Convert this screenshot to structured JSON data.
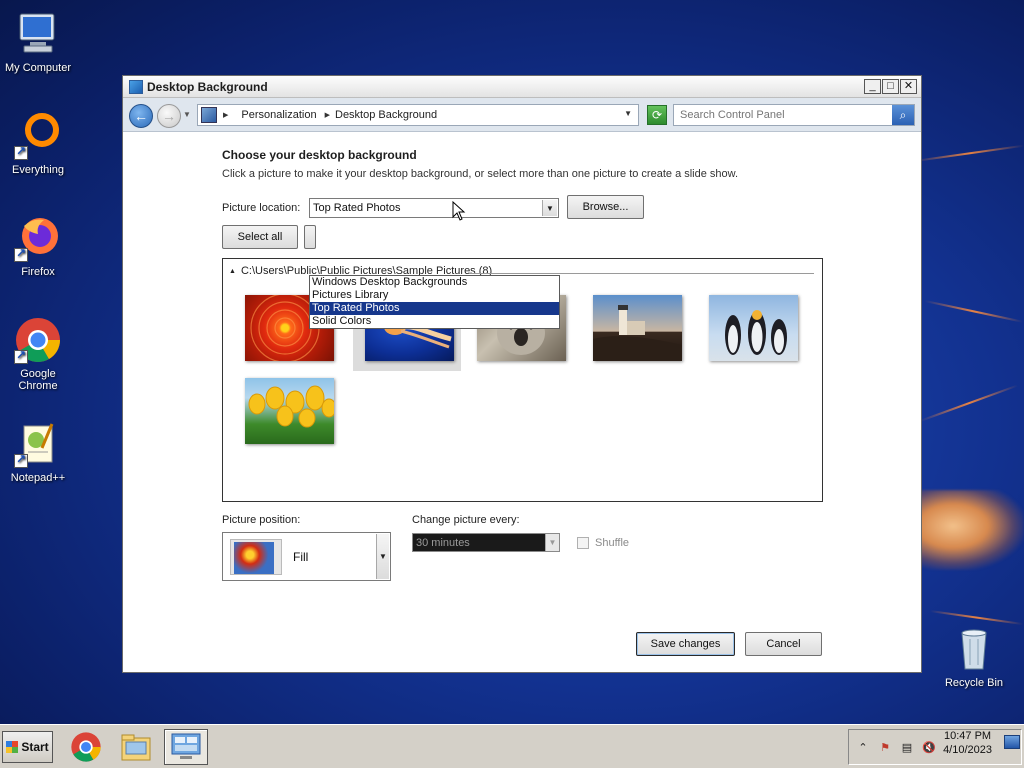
{
  "desktop": {
    "icons": [
      {
        "label": "My Computer"
      },
      {
        "label": "Everything"
      },
      {
        "label": "Firefox"
      },
      {
        "label": "Google Chrome"
      },
      {
        "label": "Notepad++"
      },
      {
        "label": "Recycle Bin"
      }
    ]
  },
  "window": {
    "title": "Desktop Background",
    "controls": {
      "minimize": "_",
      "maximize": "□",
      "close": "✕"
    }
  },
  "addressbar": {
    "crumbs": [
      "Personalization",
      "Desktop Background"
    ],
    "search_placeholder": "Search Control Panel"
  },
  "main": {
    "heading": "Choose your desktop background",
    "subtitle": "Click a picture to make it your desktop background, or select more than one picture to create a slide show.",
    "picture_location_label": "Picture location:",
    "picture_location_value": "Top Rated Photos",
    "browse_label": "Browse...",
    "select_all_label": "Select all",
    "dropdown_options": [
      "Windows Desktop Backgrounds",
      "Pictures Library",
      "Top Rated Photos",
      "Solid Colors"
    ],
    "dropdown_selected_index": 2,
    "group_header": "C:\\Users\\Public\\Public Pictures\\Sample Pictures (8)",
    "thumbnails": [
      {
        "name": "chrysanthemum",
        "checked": false
      },
      {
        "name": "jellyfish",
        "checked": true
      },
      {
        "name": "koala",
        "checked": false
      },
      {
        "name": "lighthouse",
        "checked": false
      },
      {
        "name": "penguins",
        "checked": false
      },
      {
        "name": "tulips",
        "checked": false
      }
    ],
    "picture_position_label": "Picture position:",
    "picture_position_value": "Fill",
    "change_picture_label": "Change picture every:",
    "change_picture_value": "30 minutes",
    "shuffle_label": "Shuffle",
    "save_label": "Save changes",
    "cancel_label": "Cancel"
  },
  "taskbar": {
    "start_label": "Start",
    "time": "10:47 PM",
    "date": "4/10/2023"
  }
}
